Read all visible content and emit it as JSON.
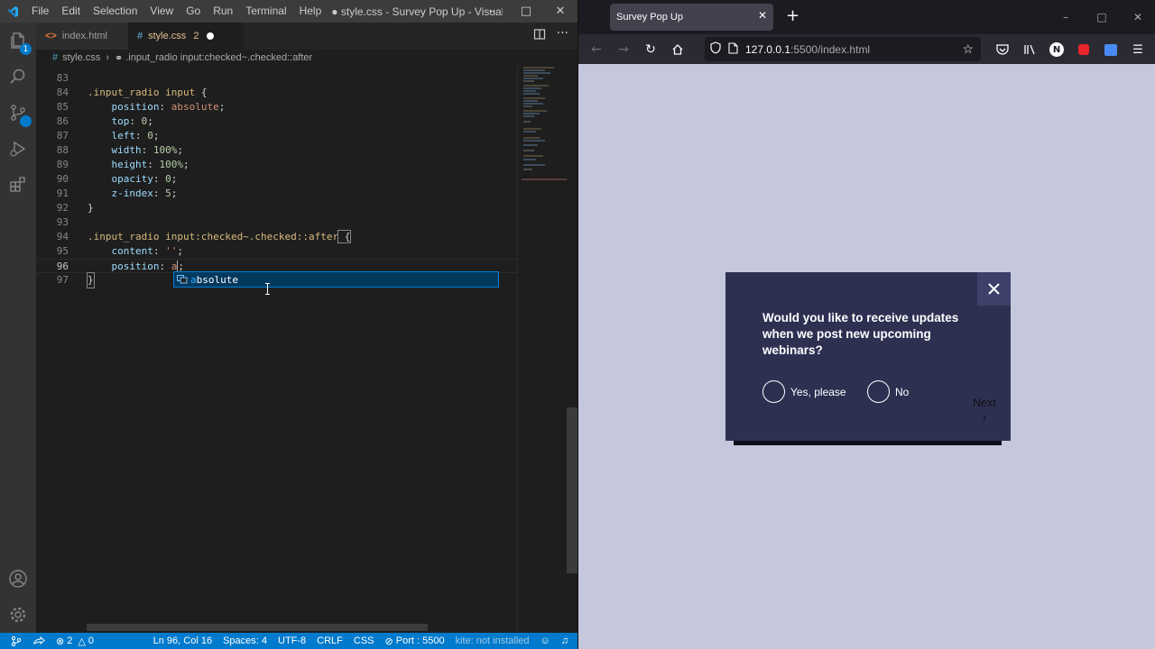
{
  "vscode": {
    "menu": [
      "File",
      "Edit",
      "Selection",
      "View",
      "Go",
      "Run",
      "Terminal",
      "Help"
    ],
    "window_title": "● style.css - Survey Pop Up - Visual Studio...",
    "tabs": [
      {
        "label": "index.html"
      },
      {
        "label": "style.css",
        "badge": "2"
      }
    ],
    "breadcrumb": {
      "file": "style.css",
      "symbol": ".input_radio input:checked~.checked::after"
    },
    "lines": [
      {
        "n": "83",
        "text": ""
      },
      {
        "n": "84",
        "sel": ".input_radio input",
        "open": " {"
      },
      {
        "n": "85",
        "prop": "position",
        "val": "absolute",
        "kind": "val"
      },
      {
        "n": "86",
        "prop": "top",
        "val": "0",
        "kind": "num"
      },
      {
        "n": "87",
        "prop": "left",
        "val": "0",
        "kind": "num"
      },
      {
        "n": "88",
        "prop": "width",
        "val": "100%",
        "kind": "num"
      },
      {
        "n": "89",
        "prop": "height",
        "val": "100%",
        "kind": "num"
      },
      {
        "n": "90",
        "prop": "opacity",
        "val": "0",
        "kind": "num"
      },
      {
        "n": "91",
        "prop": "z-index",
        "val": "5",
        "kind": "num"
      },
      {
        "n": "92",
        "text": "}"
      },
      {
        "n": "93",
        "text": ""
      },
      {
        "n": "94",
        "sel": ".input_radio input:checked~.checked::after",
        "open": " {"
      },
      {
        "n": "95",
        "prop": "content",
        "val": "''",
        "kind": "val"
      },
      {
        "n": "96",
        "prop": "position",
        "val": "a",
        "kind": "val"
      },
      {
        "n": "97",
        "text": "}"
      }
    ],
    "suggestion": {
      "match": "a",
      "rest": "bsolute"
    },
    "status": {
      "errors": "2",
      "warnings": "0",
      "position": "Ln 96, Col 16",
      "spaces": "Spaces: 4",
      "encoding": "UTF-8",
      "eol": "CRLF",
      "language": "CSS",
      "port": "Port : 5500",
      "extension": "kite: not installed"
    }
  },
  "browser": {
    "tab_title": "Survey Pop Up",
    "url_host": "127.0.0.1",
    "url_rest": ":5500/index.html",
    "profile_letter": "N",
    "popup": {
      "question": "Would you like to receive updates when we post new upcoming webinars?",
      "options": [
        "Yes, please",
        "No"
      ],
      "next_label": "Next",
      "colors": {
        "panel": "#2e3052",
        "close_bg": "#3d4069",
        "page_bg": "#c5c8dc"
      }
    }
  }
}
